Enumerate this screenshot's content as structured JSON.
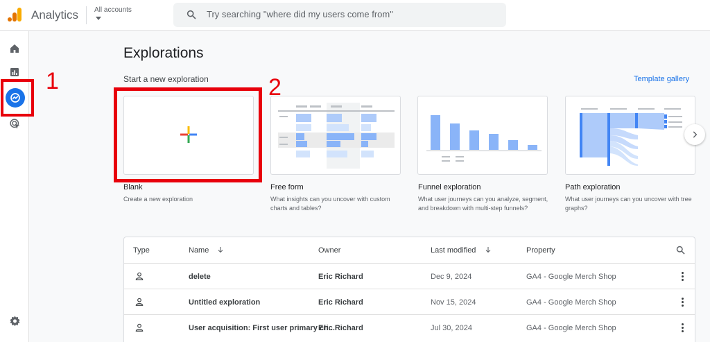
{
  "app": {
    "name": "Analytics",
    "accounts_label": "All accounts"
  },
  "search": {
    "placeholder": "Try searching \"where did my users come from\""
  },
  "annotations": {
    "marker_1": "1",
    "marker_2": "2"
  },
  "main": {
    "title": "Explorations",
    "subtitle": "Start a new exploration",
    "template_gallery": "Template gallery"
  },
  "cards": [
    {
      "title": "Blank",
      "desc": "Create a new exploration"
    },
    {
      "title": "Free form",
      "desc": "What insights can you uncover with custom charts and tables?"
    },
    {
      "title": "Funnel exploration",
      "desc": "What user journeys can you analyze, segment, and breakdown with multi-step funnels?"
    },
    {
      "title": "Path exploration",
      "desc": "What user journeys can you uncover with tree graphs?"
    }
  ],
  "table": {
    "headers": {
      "type": "Type",
      "name": "Name",
      "owner": "Owner",
      "last_modified": "Last modified",
      "property": "Property"
    },
    "rows": [
      {
        "name": "delete",
        "owner": "Eric Richard",
        "modified": "Dec 9, 2024",
        "property": "GA4 - Google Merch Shop"
      },
      {
        "name": "Untitled exploration",
        "owner": "Eric Richard",
        "modified": "Nov 15, 2024",
        "property": "GA4 - Google Merch Shop"
      },
      {
        "name": "User acquisition: First user primary ch...",
        "owner": "Eric Richard",
        "modified": "Jul 30, 2024",
        "property": "GA4 - Google Merch Shop"
      }
    ]
  },
  "colors": {
    "accent": "#1a73e8",
    "annotation": "#e8000b"
  },
  "icons": [
    "analytics-logo-icon",
    "search-icon",
    "home-icon",
    "reports-icon",
    "explore-icon",
    "advertising-icon",
    "settings-icon",
    "plus-icon",
    "chevron-right-icon",
    "sort-down-icon",
    "person-icon",
    "more-vert-icon"
  ]
}
